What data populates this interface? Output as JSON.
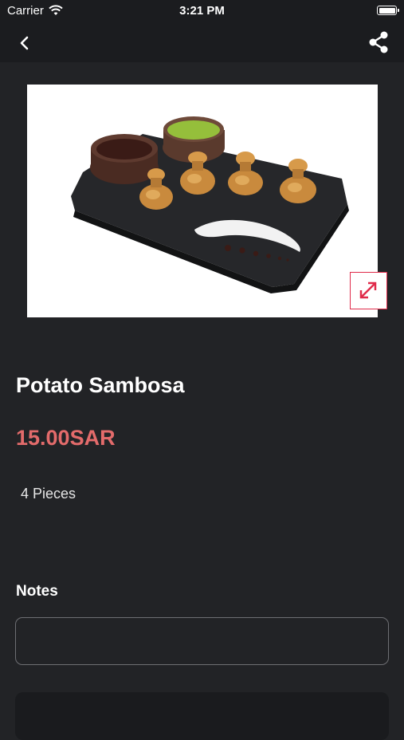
{
  "status_bar": {
    "carrier": "Carrier",
    "time": "3:21 PM"
  },
  "nav": {
    "back_icon": "chevron-left-icon",
    "share_icon": "share-icon"
  },
  "product": {
    "name": "Potato Sambosa",
    "price": "15.00SAR",
    "description": "4 Pieces",
    "image_subject": "four fried sambosa on black slate with two sauce bowls",
    "expand_icon": "expand-arrows-icon"
  },
  "notes": {
    "label": "Notes",
    "value": "",
    "placeholder": ""
  },
  "colors": {
    "background": "#222326",
    "bar": "#1b1c1f",
    "accent": "#e02b4a",
    "price": "#e36b6b"
  }
}
